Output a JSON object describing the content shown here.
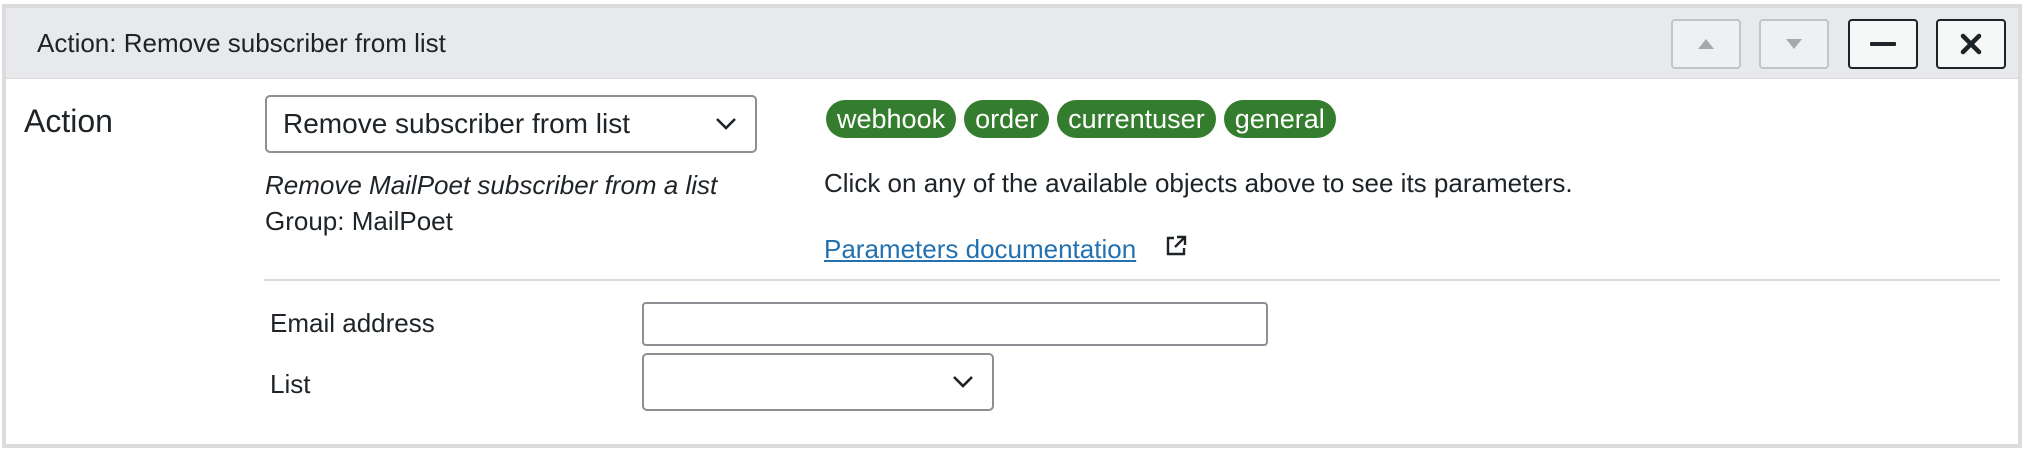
{
  "panel": {
    "title": "Action: Remove subscriber from list",
    "buttons": {
      "move_up": "move-up",
      "move_down": "move-down",
      "collapse": "collapse",
      "close": "close"
    }
  },
  "action": {
    "label": "Action",
    "selected": "Remove subscriber from list",
    "description": "Remove MailPoet subscriber from a list",
    "group": "Group: MailPoet"
  },
  "objects": {
    "tags": [
      "webhook",
      "order",
      "currentuser",
      "general"
    ],
    "help_text": "Click on any of the available objects above to see its parameters.",
    "doc_link": "Parameters documentation"
  },
  "fields": {
    "email_label": "Email address",
    "email_value": "",
    "list_label": "List",
    "list_value": ""
  },
  "colors": {
    "tag_bg": "#347c2e",
    "link": "#2271b1",
    "header_bg": "#e8e9eb"
  }
}
